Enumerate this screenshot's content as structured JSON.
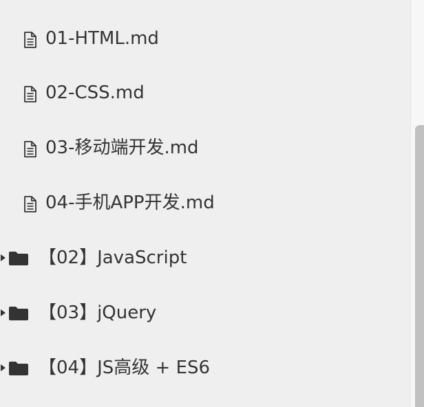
{
  "sidebar": {
    "files": [
      {
        "label": "01-HTML.md",
        "icon": "document-icon"
      },
      {
        "label": "02-CSS.md",
        "icon": "document-icon"
      },
      {
        "label": "03-移动端开发.md",
        "icon": "document-icon"
      },
      {
        "label": "04-手机APP开发.md",
        "icon": "document-icon"
      }
    ],
    "folders": [
      {
        "label": "【02】JavaScript",
        "icon": "folder-icon",
        "expanded": false
      },
      {
        "label": "【03】jQuery",
        "icon": "folder-icon",
        "expanded": false
      },
      {
        "label": "【04】JS高级 + ES6",
        "icon": "folder-icon",
        "expanded": false
      }
    ]
  },
  "colors": {
    "background": "#efefef",
    "text": "#333333",
    "icon": "#333333",
    "scrollbar_thumb": "#c1c1c1"
  }
}
